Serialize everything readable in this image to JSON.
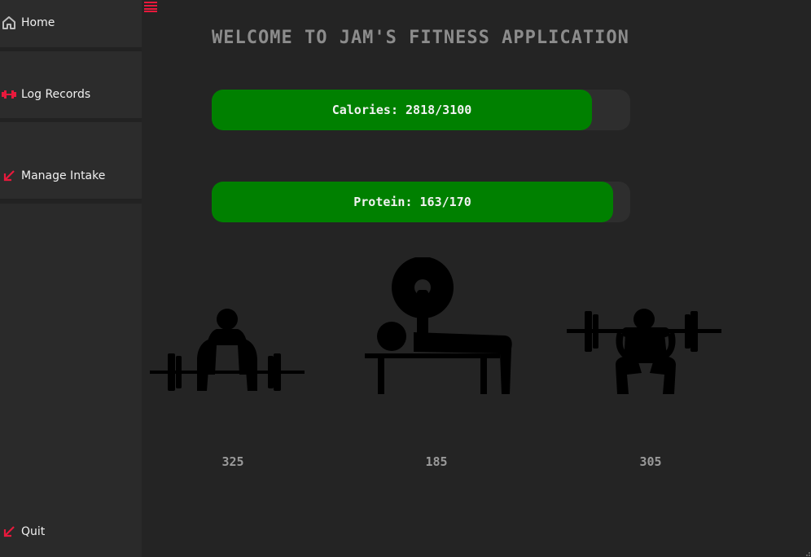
{
  "sidebar": {
    "items": [
      {
        "label": "Home",
        "icon": "home-icon"
      },
      {
        "label": "Log Records",
        "icon": "dumbbell-icon"
      },
      {
        "label": "Manage Intake",
        "icon": "arrow-down-left-icon"
      }
    ],
    "quit": {
      "label": "Quit",
      "icon": "arrow-down-left-icon"
    }
  },
  "header": {
    "title": "WELCOME TO JAM'S FITNESS APPLICATION"
  },
  "progress": {
    "calories": {
      "label": "Calories: 2818/3100",
      "fraction": 0.909
    },
    "protein": {
      "label": "Protein: 163/170",
      "fraction": 0.959
    }
  },
  "lifts": [
    {
      "value": "325",
      "icon": "deadlift-icon"
    },
    {
      "value": "185",
      "icon": "bench-press-icon"
    },
    {
      "value": "305",
      "icon": "squat-icon"
    }
  ],
  "colors": {
    "accent": "#e8193c",
    "progress_fill": "#008000",
    "background": "#242424",
    "sidebar": "#2a2a2a"
  }
}
